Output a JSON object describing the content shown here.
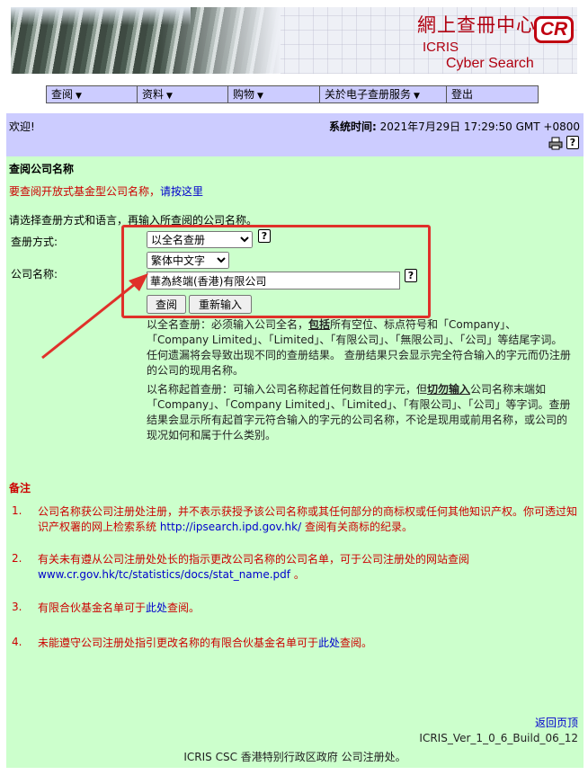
{
  "banner": {
    "title_cn": "網上查冊中心",
    "logo": "CR",
    "title_icris": "ICRIS",
    "title_en": "Cyber Search Centre"
  },
  "nav": [
    {
      "label": "查阅",
      "caret": "▼"
    },
    {
      "label": "资料",
      "caret": "▼"
    },
    {
      "label": "购物",
      "caret": "▼"
    },
    {
      "label": "关於电子查册服务",
      "caret": "▼"
    },
    {
      "label": "登出",
      "caret": ""
    }
  ],
  "welcome": {
    "greeting": "欢迎!",
    "systime_label": "系统时间:",
    "systime_value": "2021年7月29日 17:29:50 GMT +0800",
    "print_icon": "printer-icon",
    "help_icon": "help-icon"
  },
  "form": {
    "section_title": "查阅公司名称",
    "fund_text": "要查阅开放式基金型公司名称，",
    "fund_link": "请按这里",
    "instruction": "请选择查册方式和语言，再输入所查阅的公司名称。",
    "method_label": "查册方式:",
    "method_value": "以全名查册",
    "language_value": "繁体中文字",
    "name_label": "公司名称:",
    "name_value": "華為終端(香港)有限公司",
    "query_button": "查阅",
    "reset_button": "重新输入",
    "help_glyph": "?"
  },
  "explain": {
    "p1_a": "以全名查册：必须输入公司全名，",
    "p1_bold": "包括",
    "p1_b": "所有空位、标点符号和「Company」、「Company Limited」、「Limited」、「有限公司」、「無限公司」、「公司」等结尾字词。 任何遗漏将会导致出现不同的查册结果。 查册结果只会显示完全符合输入的字元而仍注册的公司的现用名称。",
    "p2_a": "以名称起首查册：可输入公司名称起首任何数目的字元，但",
    "p2_bold": "切勿输入",
    "p2_b": "公司名称末端如 「Company」、「Company Limited」、「Limited」、「有限公司」、「公司」等字词。查册结果会显示所有起首字元符合输入的字元的公司名称，不论是现用或前用名称，或公司的现况如何和属于什么类别。"
  },
  "notes": {
    "title": "备注",
    "items": [
      {
        "num": "1.",
        "text": "公司名称获公司注册处注册，并不表示获授予该公司名称或其任何部分的商标权或任何其他知识产权。你可透过知识产权署的网上检索系统 ",
        "link": "http://ipsearch.ipd.gov.hk/",
        "after": " 查阅有关商标的纪录。"
      },
      {
        "num": "2.",
        "text": "有关未有遵从公司注册处处长的指示更改公司名称的公司名单，可于公司注册处的网站查阅 ",
        "link": "www.cr.gov.hk/tc/statistics/docs/stat_name.pdf",
        "after": " 。"
      },
      {
        "num": "3.",
        "text": "有限合伙基金名单可于",
        "link": "此处",
        "after": "查阅。"
      },
      {
        "num": "4.",
        "text": "未能遵守公司注册处指引更改名称的有限合伙基金名单可于",
        "link": "此处",
        "after": "查阅。"
      }
    ]
  },
  "footer": {
    "back_to_top": "返回页顶",
    "version": "ICRIS_Ver_1_0_6_Build_06_12",
    "copyright": "ICRIS CSC 香港特别行政区政府 公司注册处。"
  },
  "colors": {
    "nav_bg": "#ccccff",
    "content_bg": "#ccffcc",
    "note_red": "#cc0000",
    "link_blue": "#0000cc",
    "annotation_red": "#e0302a"
  }
}
